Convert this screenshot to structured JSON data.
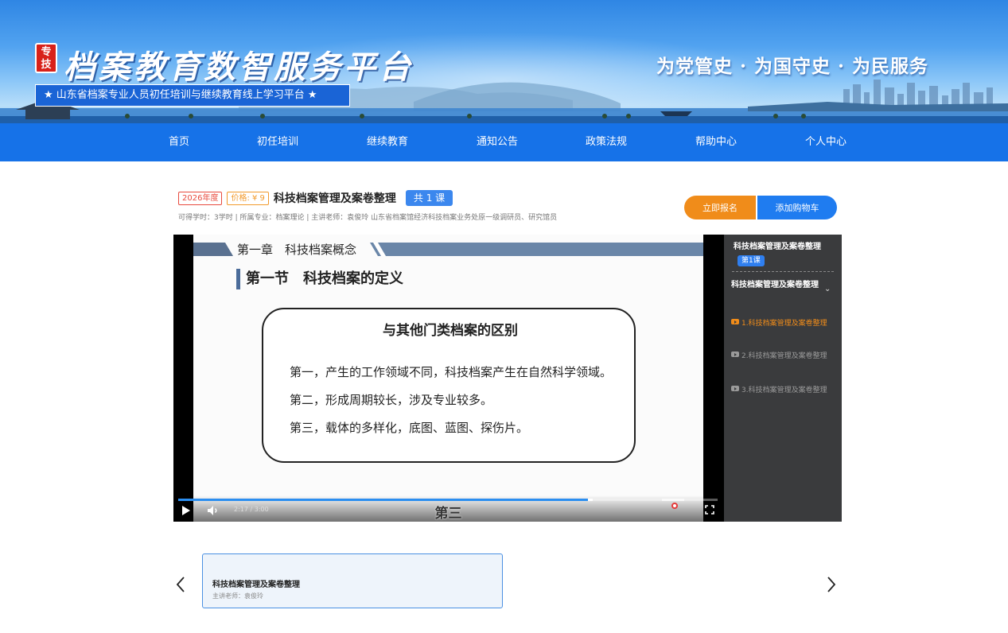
{
  "banner": {
    "logo_badge_text": "专技",
    "site_title": "档案教育数智服务平台",
    "subtitle": "★ 山东省档案专业人员初任培训与继续教育线上学习平台 ★",
    "slogan": "为党管史 · 为国守史 · 为民服务"
  },
  "nav": {
    "items": [
      {
        "label": "首页"
      },
      {
        "label": "初任培训"
      },
      {
        "label": "继续教育"
      },
      {
        "label": "通知公告"
      },
      {
        "label": "政策法规"
      },
      {
        "label": "帮助中心"
      },
      {
        "label": "个人中心"
      }
    ]
  },
  "course": {
    "year_tag": "2026年度",
    "price_tag": "价格: ¥ 9",
    "title": "科技档案管理及案卷整理",
    "lesson_count": "共 1 课",
    "meta": "可得学时：3学时 | 所属专业：档案理论 | 主讲老师：袁俊玲 山东省档案馆经济科技档案业务处原一级调研员、研究馆员",
    "enroll_label": "立即报名",
    "cart_label": "添加购物车"
  },
  "slide": {
    "chapter": "第一章　科技档案概念",
    "section": "第一节　科技档案的定义",
    "card_title": "与其他门类档案的区别",
    "points": [
      "第一，产生的工作领域不同，科技档案产生在自然科学领域。",
      "第二，形成周期较长，涉及专业较多。",
      "第三，载体的多样化，底图、蓝图、探伤片。"
    ],
    "subtitle_overlay": "第三"
  },
  "player": {
    "time": "2:17 / 3:00",
    "progress": 0.76,
    "accent": "#2b8ef0"
  },
  "playlist": {
    "course_title": "科技档案管理及案卷整理",
    "badge": "第1课",
    "chapter_title": "科技档案管理及案卷整理",
    "items": [
      {
        "label": "1.科技档案管理及案卷整理",
        "active": true
      },
      {
        "label": "2.科技档案管理及案卷整理",
        "active": false
      },
      {
        "label": "3.科技档案管理及案卷整理",
        "active": false
      }
    ]
  },
  "lesson_card": {
    "title": "科技档案管理及案卷整理",
    "teacher": "主讲老师：袁俊玲"
  },
  "colors": {
    "nav_bg": "#1672e8",
    "enroll_button": "#f08c1a",
    "cart_button": "#1f7cf0",
    "active_item": "#f08c1a"
  }
}
